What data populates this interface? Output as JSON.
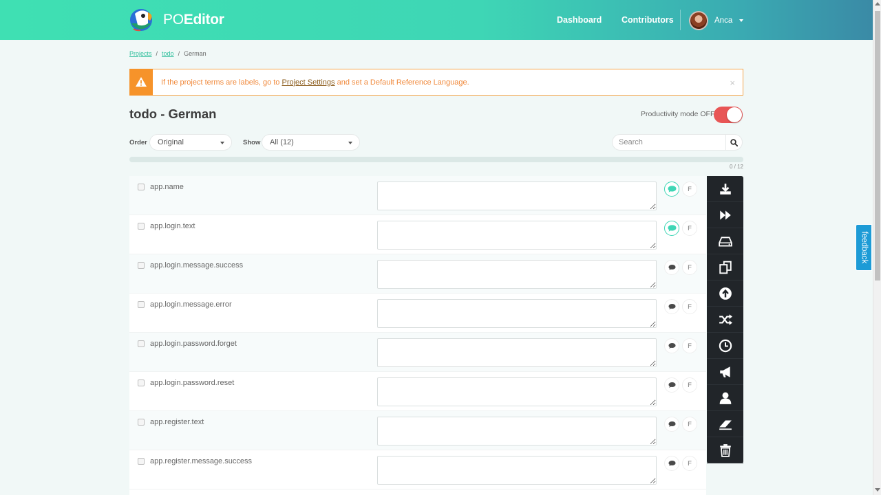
{
  "header": {
    "logo_prefix": "PO",
    "logo_bold": "Editor",
    "nav": {
      "dashboard": "Dashboard",
      "contributors": "Contributors"
    },
    "user": {
      "name": "Anca"
    }
  },
  "breadcrumb": {
    "projects": "Projects",
    "project": "todo",
    "current": "German"
  },
  "alert": {
    "text_before": "If the project terms are labels, go to",
    "link": "Project Settings",
    "text_after": "and set a Default Reference Language.",
    "close": "×"
  },
  "page": {
    "title": "todo - German",
    "productivity_label": "Productivity mode OFF",
    "productivity_on": false
  },
  "filters": {
    "order_label": "Order",
    "order_value": "Original",
    "show_label": "Show",
    "show_value": "All (12)",
    "search_placeholder": "Search"
  },
  "progress": {
    "count_text": "0 / 12",
    "fraction": 0
  },
  "terms": [
    {
      "term": "app.name",
      "comment_active": true,
      "f_label": "F"
    },
    {
      "term": "app.login.text",
      "comment_active": true,
      "f_label": "F"
    },
    {
      "term": "app.login.message.success",
      "comment_active": false,
      "f_label": "F"
    },
    {
      "term": "app.login.message.error",
      "comment_active": false,
      "f_label": "F"
    },
    {
      "term": "app.login.password.forget",
      "comment_active": false,
      "f_label": "F"
    },
    {
      "term": "app.login.password.reset",
      "comment_active": false,
      "f_label": "F"
    },
    {
      "term": "app.register.text",
      "comment_active": false,
      "f_label": "F"
    },
    {
      "term": "app.register.message.success",
      "comment_active": false,
      "f_label": "F"
    }
  ],
  "tools": [
    "download-icon",
    "fast-forward-icon",
    "drive-icon",
    "copy-icon",
    "upload-icon",
    "shuffle-icon",
    "history-icon",
    "megaphone-icon",
    "user-icon",
    "eraser-icon",
    "trash-icon"
  ],
  "feedback": {
    "label": "feedback"
  },
  "colors": {
    "brand_green": "#3ed6b5",
    "alert_orange": "#f6932a",
    "toggle_off_red": "#e85555",
    "toolbar_dark": "#212529",
    "feedback_blue": "#1d9bd6"
  }
}
